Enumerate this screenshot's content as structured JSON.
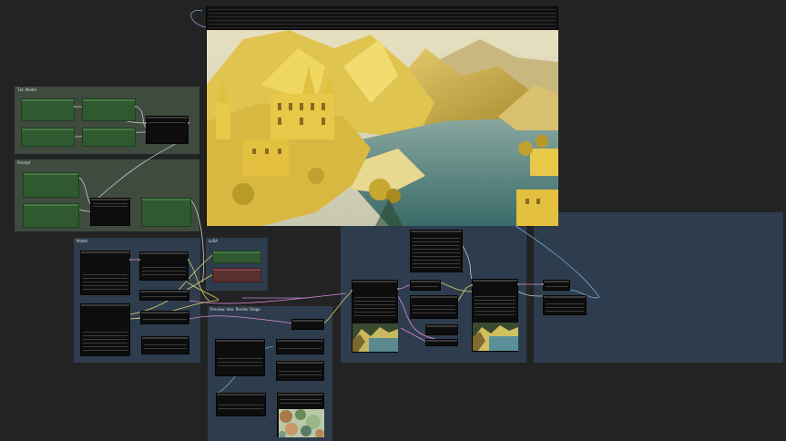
{
  "groups": {
    "g1": "Txt. Model",
    "g2": "Prompt",
    "g3": "Model",
    "g4": "LoRA",
    "g5": "Preview. Vae. Render Stage"
  },
  "colors": {
    "canvas": "#232323",
    "group_green": "#3f4b3f",
    "group_blue": "#2e3d4d",
    "node_green": "#2f5a2f",
    "node_red": "#5a2f2f",
    "node_black": "#0d0d0d"
  }
}
